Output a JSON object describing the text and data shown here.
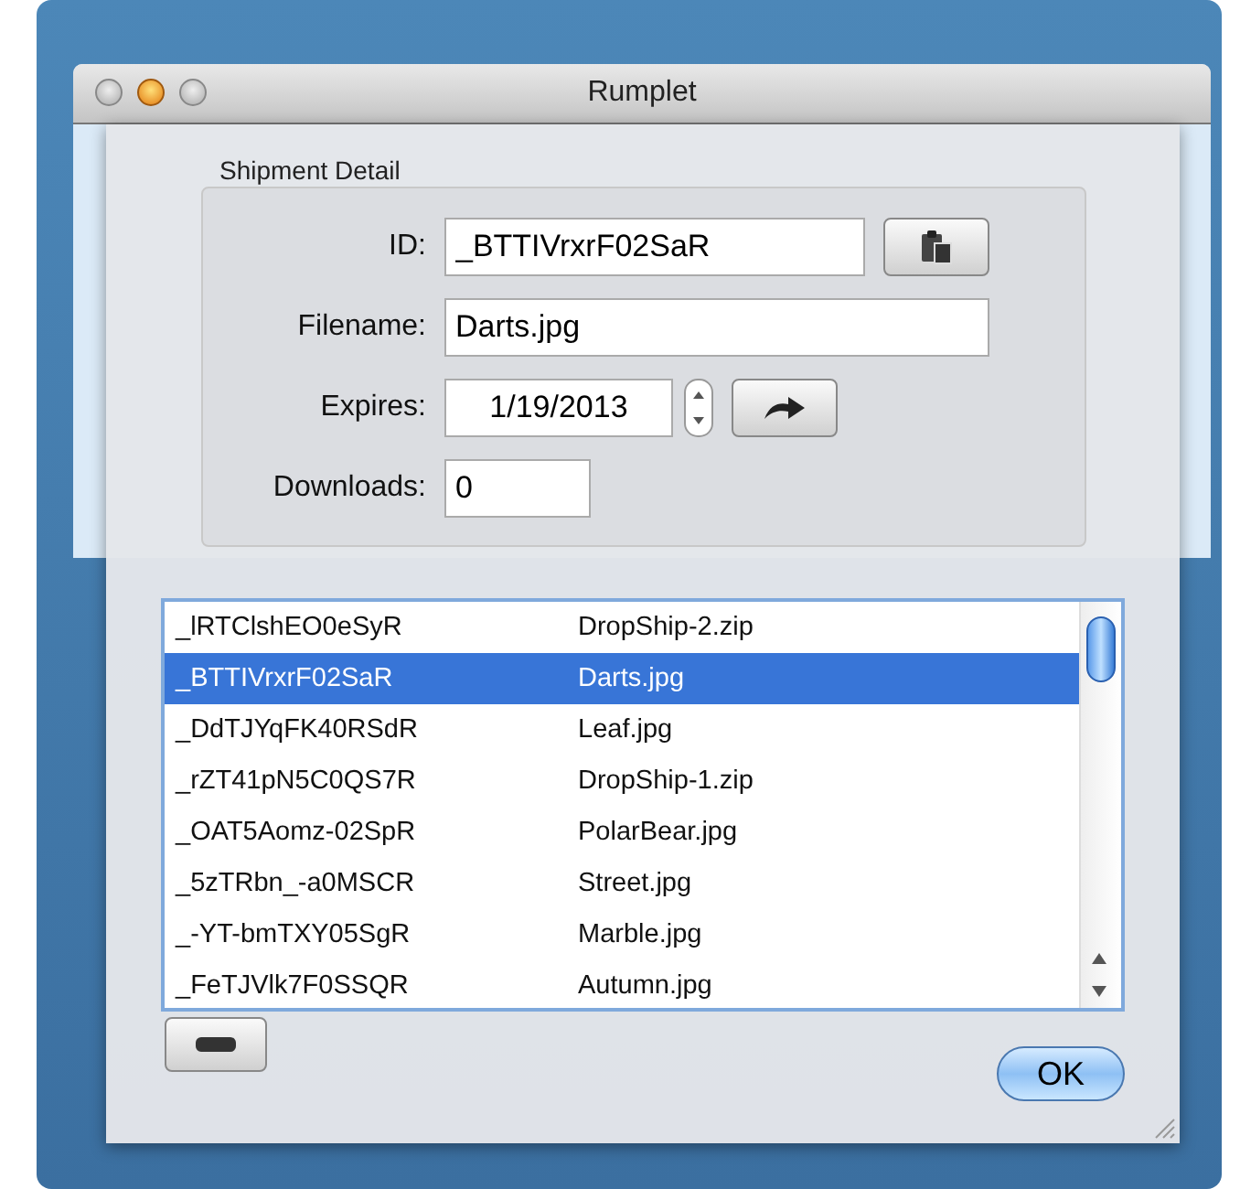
{
  "window": {
    "title": "Rumplet"
  },
  "sheet": {
    "group_title": "Shipment Detail",
    "fields": [
      {
        "kind": "copy",
        "label": "ID:",
        "value": "_BTTIVrxrF02SaR"
      },
      {
        "kind": "wide",
        "label": "Filename:",
        "value": "Darts.jpg"
      },
      {
        "kind": "date",
        "label": "Expires:",
        "value": "1/19/2013"
      },
      {
        "kind": "short",
        "label": "Downloads:",
        "value": "0"
      }
    ],
    "rows": [
      {
        "id": "_lRTClshEO0eSyR",
        "file": "DropShip-2.zip",
        "selected": false
      },
      {
        "id": "_BTTIVrxrF02SaR",
        "file": "Darts.jpg",
        "selected": true
      },
      {
        "id": "_DdTJYqFK40RSdR",
        "file": "Leaf.jpg",
        "selected": false
      },
      {
        "id": "_rZT41pN5C0QS7R",
        "file": "DropShip-1.zip",
        "selected": false
      },
      {
        "id": "_OAT5Aomz-02SpR",
        "file": "PolarBear.jpg",
        "selected": false
      },
      {
        "id": "_5zTRbn_-a0MSCR",
        "file": "Street.jpg",
        "selected": false
      },
      {
        "id": "_-YT-bmTXY05SgR",
        "file": "Marble.jpg",
        "selected": false
      },
      {
        "id": "_FeTJVlk7F0SSQR",
        "file": "Autumn.jpg",
        "selected": false
      }
    ],
    "ok_button": "OK"
  }
}
